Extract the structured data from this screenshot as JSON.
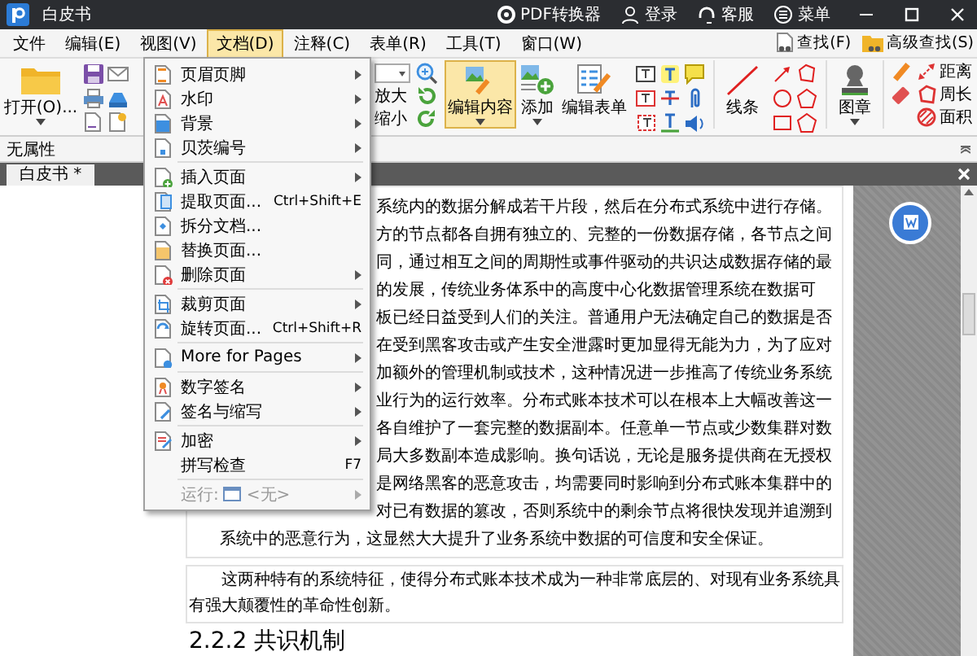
{
  "window": {
    "title": "白皮书",
    "actions": [
      "PDF转换器",
      "登录",
      "客服",
      "菜单"
    ]
  },
  "menu_bar": {
    "items": [
      {
        "label": "文件",
        "selected": false
      },
      {
        "label": "编辑(E)",
        "selected": false
      },
      {
        "label": "视图(V)",
        "selected": false
      },
      {
        "label": "文档(D)",
        "selected": true
      },
      {
        "label": "注释(C)",
        "selected": false
      },
      {
        "label": "表单(R)",
        "selected": false
      },
      {
        "label": "工具(T)",
        "selected": false
      },
      {
        "label": "窗口(W)",
        "selected": false
      }
    ],
    "search": [
      "查找(F)",
      "高级查找(S)"
    ]
  },
  "ribbon": {
    "open_button": "打开(O)...",
    "zoom_in": "放大",
    "zoom_out": "缩小",
    "tools": [
      {
        "label": "编辑内容",
        "kind": "dropdown",
        "selected": true
      },
      {
        "label": "添加",
        "kind": "dropdown",
        "selected": false
      },
      {
        "label": "编辑表单",
        "kind": "button",
        "selected": false
      }
    ],
    "line_tool": "线条",
    "stamp_tool": "图章",
    "measure_tools": [
      "距离",
      "周长",
      "面积"
    ]
  },
  "property_bar": {
    "label": "无属性"
  },
  "tabs": [
    {
      "label": "白皮书 *",
      "selected": true
    }
  ],
  "document_menu": {
    "groups": [
      [
        {
          "kind": "command",
          "label": "页眉页脚",
          "submenu": true,
          "disabled": false
        },
        {
          "kind": "command",
          "label": "水印",
          "submenu": true,
          "disabled": false
        },
        {
          "kind": "command",
          "label": "背景",
          "submenu": true,
          "disabled": false
        },
        {
          "kind": "command",
          "label": "贝茨编号",
          "submenu": true,
          "disabled": false
        }
      ],
      [
        {
          "kind": "command",
          "label": "插入页面",
          "submenu": true,
          "disabled": false
        },
        {
          "kind": "command",
          "label": "提取页面...",
          "shortcut": "Ctrl+Shift+E",
          "submenu": false,
          "disabled": false
        },
        {
          "kind": "command",
          "label": "拆分文档...",
          "submenu": false,
          "disabled": false
        },
        {
          "kind": "command",
          "label": "替换页面...",
          "submenu": false,
          "disabled": false
        },
        {
          "kind": "command",
          "label": "删除页面",
          "submenu": true,
          "disabled": false
        }
      ],
      [
        {
          "kind": "command",
          "label": "裁剪页面",
          "submenu": true,
          "disabled": false
        },
        {
          "kind": "command",
          "label": "旋转页面...",
          "shortcut": "Ctrl+Shift+R",
          "submenu": false,
          "disabled": false
        }
      ],
      [
        {
          "kind": "command",
          "label": "More for Pages",
          "submenu": true,
          "disabled": false
        }
      ],
      [
        {
          "kind": "command",
          "label": "数字签名",
          "submenu": true,
          "disabled": false
        },
        {
          "kind": "command",
          "label": "签名与缩写",
          "submenu": true,
          "disabled": false
        }
      ],
      [
        {
          "kind": "command",
          "label": "加密",
          "submenu": true,
          "disabled": false
        },
        {
          "kind": "command",
          "label": "拼写检查",
          "shortcut": "F7",
          "submenu": false,
          "disabled": false
        }
      ],
      [
        {
          "kind": "run",
          "label": "运行:",
          "value": "<无>",
          "submenu": true,
          "disabled": true
        }
      ]
    ]
  },
  "document": {
    "cut_lines": [
      "系统内的数据分解成若干片段，然后在分布式系统中进行存储。",
      "方的节点都各自拥有独立的、完整的一份数据存储，各节点之间",
      "同，通过相互之间的周期性或事件驱动的共识达成数据存储的最",
      "的发展，传统业务体系中的高度中心化数据管理系统在数据可",
      "板已经日益受到人们的关注。普通用户无法确定自己的数据是否",
      "在受到黑客攻击或产生安全泄露时更加显得无能为力，为了应对",
      "加额外的管理机制或技术，这种情况进一步推高了传统业务系统",
      "业行为的运行效率。分布式账本技术可以在根本上大幅改善这一",
      "各自维护了一套完整的数据副本。任意单一节点或少数集群对数",
      "局大多数副本造成影响。换句话说，无论是服务提供商在无授权",
      "是网络黑客的恶意攻击，均需要同时影响到分布式账本集群中的",
      "对已有数据的篡改，否则系统中的剩余节点将很快发现并追溯到"
    ],
    "lines": [
      "系统中的恶意行为，这显然大大提升了业务系统中数据的可信度和安全保证。"
    ],
    "paragraph": "这两种特有的系统特征，使得分布式账本技术成为一种非常底层的、对现有业务系统具有强大颠覆性的革命性创新。",
    "heading": "2.2.2 共识机制"
  }
}
